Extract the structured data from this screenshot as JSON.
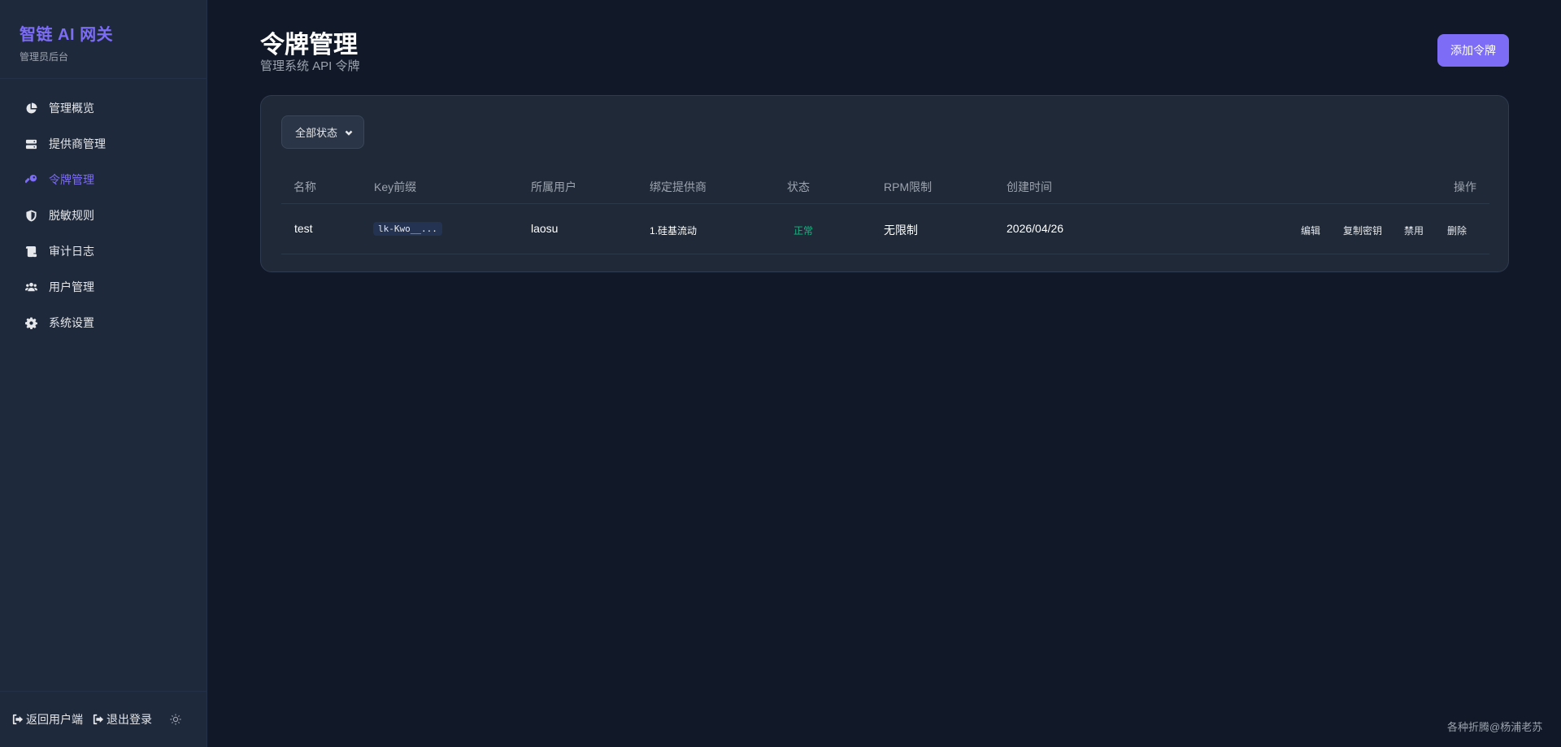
{
  "brand": {
    "title": "智链 AI 网关",
    "subtitle": "管理员后台"
  },
  "sidebar": {
    "items": [
      {
        "label": "管理概览",
        "icon": "pie-chart-icon"
      },
      {
        "label": "提供商管理",
        "icon": "server-icon"
      },
      {
        "label": "令牌管理",
        "icon": "key-icon",
        "active": true
      },
      {
        "label": "脱敏规则",
        "icon": "shield-icon"
      },
      {
        "label": "审计日志",
        "icon": "scroll-icon"
      },
      {
        "label": "用户管理",
        "icon": "users-icon"
      },
      {
        "label": "系统设置",
        "icon": "gear-icon"
      }
    ],
    "footer": {
      "back_label": "返回用户端",
      "logout_label": "退出登录",
      "theme_icon": "sun-icon"
    }
  },
  "header": {
    "title": "令牌管理",
    "subtitle": "管理系统 API 令牌",
    "add_button": "添加令牌"
  },
  "filter": {
    "selected": "全部状态"
  },
  "table": {
    "columns": [
      "名称",
      "Key前缀",
      "所属用户",
      "绑定提供商",
      "状态",
      "RPM限制",
      "创建时间",
      "操作"
    ],
    "rows": [
      {
        "name": "test",
        "key_prefix": "lk-Kwo__...",
        "user": "laosu",
        "provider": "1.硅基流动",
        "status": "正常",
        "rpm": "无限制",
        "created": "2026/04/26",
        "actions": [
          "编辑",
          "复制密钥",
          "禁用",
          "删除"
        ]
      }
    ]
  },
  "colors": {
    "accent": "#7c6cf6",
    "status_ok": "#10b981",
    "background": "#111827",
    "sidebar": "#1e293b"
  },
  "watermark": "各种折腾@杨浦老苏"
}
